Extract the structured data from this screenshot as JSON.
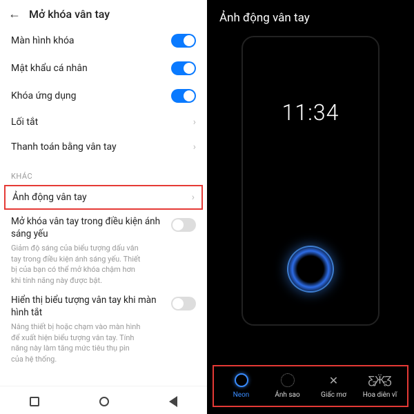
{
  "left": {
    "title": "Mở khóa vân tay",
    "rows": [
      {
        "label": "Màn hình khóa",
        "on": true
      },
      {
        "label": "Mật khẩu cá nhân",
        "on": true
      },
      {
        "label": "Khóa ứng dụng",
        "on": true
      }
    ],
    "links": [
      {
        "label": "Lối tắt"
      },
      {
        "label": "Thanh toán bằng vân tay"
      }
    ],
    "sectionLabel": "KHÁC",
    "highlight": {
      "label": "Ảnh động vân tay"
    },
    "block1": {
      "title": "Mở khóa vân tay trong điều kiện ánh sáng yếu",
      "desc": "Giảm độ sáng của biểu tượng dấu vân tay trong điều kiện ánh sáng yếu. Thiết bị của bạn có thể mở khóa chậm hơn khi tính năng này được bật."
    },
    "block2": {
      "title": "Hiển thị biểu tượng vân tay khi màn hình tắt",
      "desc": "Nâng thiết bị hoặc chạm vào màn hình để xuất hiện biểu tượng vân tay. Tính năng này làm tăng mức tiêu thụ pin của hệ thống."
    }
  },
  "right": {
    "title": "Ảnh động vân tay",
    "clock": "11:34",
    "effects": [
      {
        "label": "Neon",
        "icon": "neon",
        "selected": true
      },
      {
        "label": "Ánh sao",
        "icon": "dots",
        "selected": false
      },
      {
        "label": "Giấc mơ",
        "icon": "x",
        "selected": false
      },
      {
        "label": "Hoa diên vĩ",
        "icon": "butterfly",
        "selected": false
      }
    ]
  }
}
